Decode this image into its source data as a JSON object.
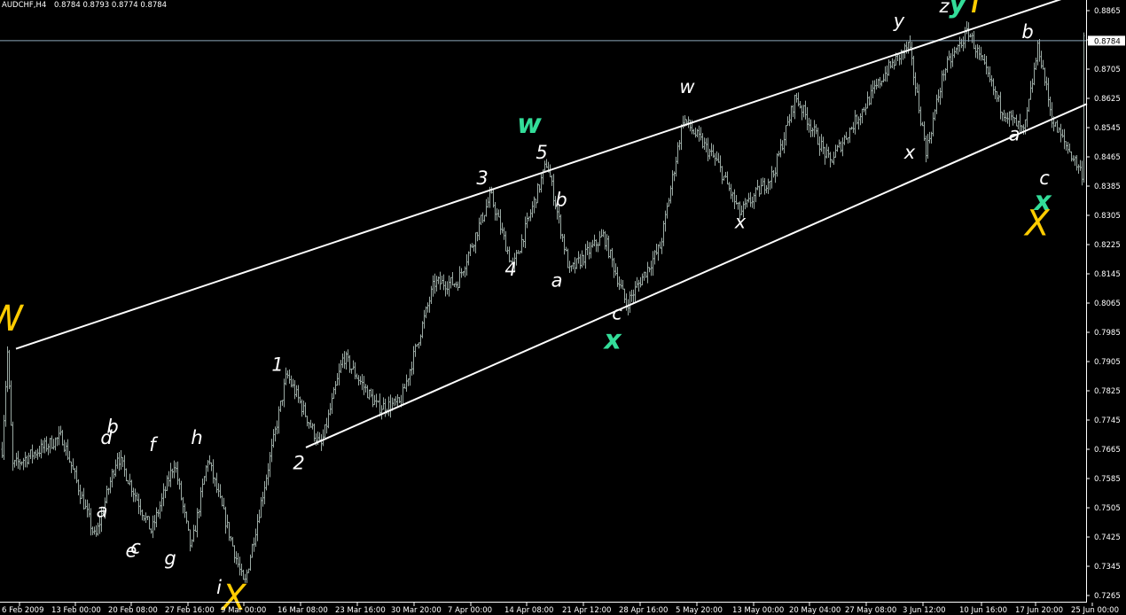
{
  "header": {
    "symbol": "AUDCHF,H4",
    "ohlc": "0.8784 0.8793 0.8774 0.8784"
  },
  "current_price_label": "0.8784",
  "chart_data": {
    "type": "bar",
    "title": "AUDCHF,H4",
    "ylim": [
      0.723,
      0.8905
    ],
    "y_ticks": [
      "0.8865",
      "0.8785",
      "0.8705",
      "0.8625",
      "0.8545",
      "0.8465",
      "0.8385",
      "0.8305",
      "0.8225",
      "0.8145",
      "0.8065",
      "0.7985",
      "0.7905",
      "0.7825",
      "0.7745",
      "0.7665",
      "0.7585",
      "0.7505",
      "0.7425",
      "0.7345",
      "0.7265"
    ],
    "x_ticks": [
      "6 Feb 2009",
      "13 Feb 00:00",
      "20 Feb 08:00",
      "27 Feb 16:00",
      "9 Mar 00:00",
      "16 Mar 08:00",
      "23 Mar 16:00",
      "30 Mar 20:00",
      "7 Apr 00:00",
      "14 Apr 08:00",
      "21 Apr 12:00",
      "28 Apr 16:00",
      "5 May 20:00",
      "13 May 00:00",
      "20 May 04:00",
      "27 May 08:00",
      "3 Jun 12:00",
      "10 Jun 16:00",
      "17 Jun 20:00",
      "25 Jun 00:00"
    ],
    "current_price": 0.8784,
    "price_path": [
      [
        "6 Feb 2009",
        0.7665
      ],
      [
        "6 Feb 2009",
        0.793
      ],
      [
        "6 Feb 2009",
        0.762
      ],
      [
        "13 Feb 00:00",
        0.77
      ],
      [
        "13 Feb 00:00",
        0.742
      ],
      [
        "20 Feb 08:00",
        0.765
      ],
      [
        "20 Feb 08:00",
        0.744
      ],
      [
        "27 Feb 16:00",
        0.763
      ],
      [
        "27 Feb 16:00",
        0.739
      ],
      [
        "27 Feb 16:00",
        0.764
      ],
      [
        "9 Mar 00:00",
        0.729
      ],
      [
        "16 Mar 08:00",
        0.787
      ],
      [
        "16 Mar 08:00",
        0.767
      ],
      [
        "23 Mar 16:00",
        0.792
      ],
      [
        "23 Mar 16:00",
        0.778
      ],
      [
        "30 Mar 20:00",
        0.779
      ],
      [
        "30 Mar 20:00",
        0.812
      ],
      [
        "7 Apr 00:00",
        0.812
      ],
      [
        "7 Apr 00:00",
        0.836
      ],
      [
        "14 Apr 08:00",
        0.816
      ],
      [
        "14 Apr 08:00",
        0.845
      ],
      [
        "21 Apr 12:00",
        0.815
      ],
      [
        "21 Apr 12:00",
        0.825
      ],
      [
        "28 Apr 16:00",
        0.806
      ],
      [
        "28 Apr 16:00",
        0.822
      ],
      [
        "5 May 20:00",
        0.857
      ],
      [
        "5 May 20:00",
        0.845
      ],
      [
        "13 May 00:00",
        0.831
      ],
      [
        "13 May 00:00",
        0.842
      ],
      [
        "20 May 04:00",
        0.863
      ],
      [
        "20 May 04:00",
        0.845
      ],
      [
        "27 May 08:00",
        0.855
      ],
      [
        "27 May 08:00",
        0.87
      ],
      [
        "3 Jun 12:00",
        0.877
      ],
      [
        "3 Jun 12:00",
        0.848
      ],
      [
        "3 Jun 12:00",
        0.87
      ],
      [
        "10 Jun 16:00",
        0.881
      ],
      [
        "10 Jun 16:00",
        0.86
      ],
      [
        "17 Jun 20:00",
        0.853
      ],
      [
        "17 Jun 20:00",
        0.877
      ],
      [
        "17 Jun 20:00",
        0.856
      ],
      [
        "25 Jun 00:00",
        0.842
      ],
      [
        "25 Jun 00:00",
        0.88
      ],
      [
        "25 Jun 00:00",
        0.8784
      ]
    ],
    "trendlines": [
      {
        "from": [
          "6 Feb 2009",
          0.794
        ],
        "to": [
          "25 Jun 00:00",
          0.892
        ]
      },
      {
        "from": [
          "16 Mar 08:00",
          0.767
        ],
        "to": [
          "25 Jun 00:00",
          0.861
        ]
      }
    ],
    "labels": [
      {
        "text": "W",
        "style": "yellow",
        "at": [
          "6 Feb 2009",
          0.799
        ]
      },
      {
        "text": "a",
        "style": "white",
        "at": [
          "13 Feb 00:00",
          0.748
        ]
      },
      {
        "text": "b",
        "style": "white",
        "at": [
          "13 Feb 00:00",
          0.771
        ]
      },
      {
        "text": "c",
        "style": "white",
        "at": [
          "13 Feb 00:00",
          0.738
        ]
      },
      {
        "text": "d",
        "style": "white",
        "at": [
          "20 Feb 08:00",
          0.768
        ]
      },
      {
        "text": "e",
        "style": "white",
        "at": [
          "20 Feb 08:00",
          0.737
        ]
      },
      {
        "text": "f",
        "style": "white",
        "at": [
          "27 Feb 16:00",
          0.766
        ]
      },
      {
        "text": "g",
        "style": "white",
        "at": [
          "27 Feb 16:00",
          0.735
        ]
      },
      {
        "text": "h",
        "style": "white",
        "at": [
          "27 Feb 16:00",
          0.768
        ]
      },
      {
        "text": "i",
        "style": "white",
        "at": [
          "9 Mar 00:00",
          0.727
        ]
      },
      {
        "text": "X",
        "style": "yellow",
        "at": [
          "9 Mar 00:00",
          0.727
        ]
      },
      {
        "text": "1",
        "style": "white",
        "at": [
          "16 Mar 08:00",
          0.788
        ]
      },
      {
        "text": "2",
        "style": "white",
        "at": [
          "16 Mar 08:00",
          0.761
        ]
      },
      {
        "text": "3",
        "style": "white",
        "at": [
          "7 Apr 00:00",
          0.839
        ]
      },
      {
        "text": "4",
        "style": "white",
        "at": [
          "14 Apr 08:00",
          0.814
        ]
      },
      {
        "text": "5",
        "style": "white",
        "at": [
          "14 Apr 08:00",
          0.846
        ]
      },
      {
        "text": "w",
        "style": "green",
        "at": [
          "14 Apr 08:00",
          0.853
        ]
      },
      {
        "text": "b",
        "style": "white",
        "at": [
          "14 Apr 08:00",
          0.833
        ]
      },
      {
        "text": "a",
        "style": "white",
        "at": [
          "21 Apr 12:00",
          0.811
        ]
      },
      {
        "text": "c",
        "style": "white",
        "at": [
          "28 Apr 16:00",
          0.802
        ]
      },
      {
        "text": "x",
        "style": "green",
        "at": [
          "28 Apr 16:00",
          0.794
        ]
      },
      {
        "text": "w",
        "style": "white",
        "at": [
          "5 May 20:00",
          0.864
        ]
      },
      {
        "text": "x",
        "style": "white",
        "at": [
          "13 May 00:00",
          0.827
        ]
      },
      {
        "text": "y",
        "style": "white",
        "at": [
          "3 Jun 12:00",
          0.882
        ]
      },
      {
        "text": "x",
        "style": "white",
        "at": [
          "3 Jun 12:00",
          0.846
        ]
      },
      {
        "text": "z",
        "style": "white",
        "at": [
          "10 Jun 16:00",
          0.886
        ]
      },
      {
        "text": "y",
        "style": "green",
        "at": [
          "10 Jun 16:00",
          0.886
        ]
      },
      {
        "text": "Y",
        "style": "yellow",
        "at": [
          "10 Jun 16:00",
          0.886
        ]
      },
      {
        "text": "b",
        "style": "white",
        "at": [
          "17 Jun 20:00",
          0.879
        ]
      },
      {
        "text": "a",
        "style": "white",
        "at": [
          "17 Jun 20:00",
          0.851
        ]
      },
      {
        "text": "c",
        "style": "white",
        "at": [
          "25 Jun 00:00",
          0.839
        ]
      },
      {
        "text": "x",
        "style": "green",
        "at": [
          "25 Jun 00:00",
          0.832
        ]
      },
      {
        "text": "X",
        "style": "yellow",
        "at": [
          "25 Jun 00:00",
          0.825
        ]
      }
    ],
    "colors": {
      "background": "#000000",
      "bars": "#9aa9a3",
      "trendline": "#ffffff",
      "price_line": "#8da6b8",
      "wave_white": "#ffffff",
      "wave_green": "#33dd99",
      "wave_yellow": "#ffcc00"
    }
  }
}
